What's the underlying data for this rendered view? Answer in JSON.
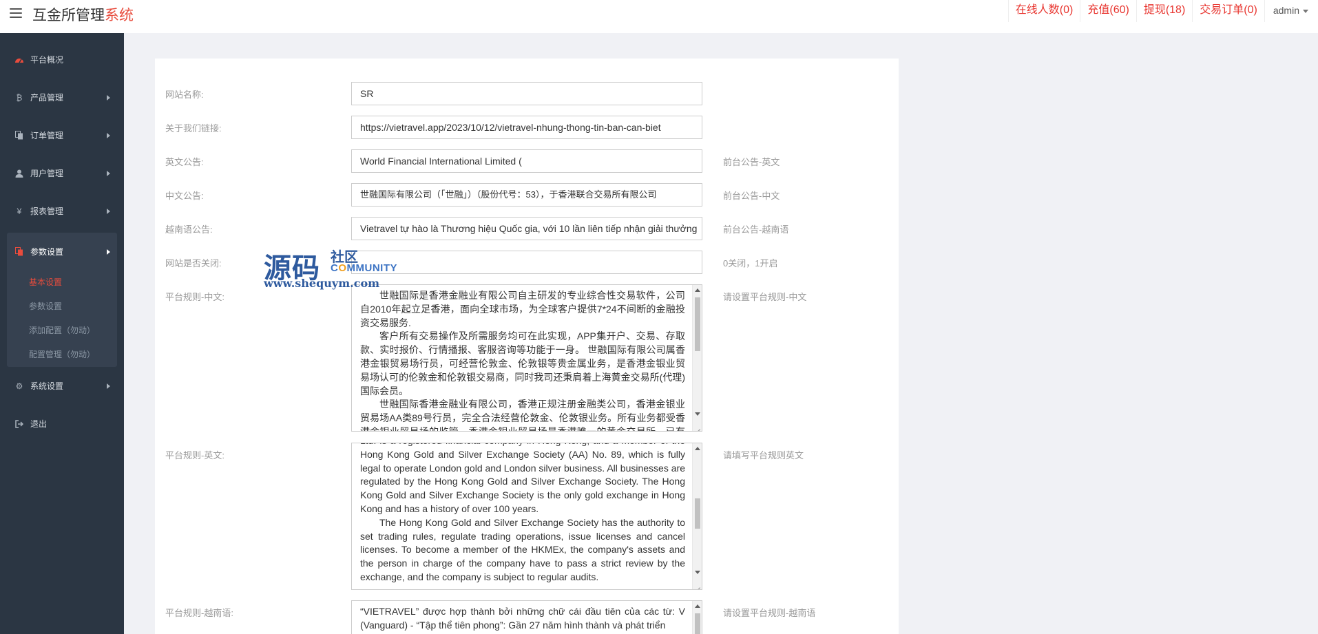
{
  "header": {
    "brand_main": "互金所管理",
    "brand_accent": "系统",
    "nav": {
      "online": "在线人数(0)",
      "recharge": "充值(60)",
      "withdraw": "提现(18)",
      "orders": "交易订单(0)",
      "user": "admin"
    }
  },
  "sidebar": {
    "items": [
      {
        "label": "平台概况",
        "icon": "dashboard-icon"
      },
      {
        "label": "产品管理",
        "icon": "bitcoin-icon"
      },
      {
        "label": "订单管理",
        "icon": "copy-icon"
      },
      {
        "label": "用户管理",
        "icon": "user-icon"
      },
      {
        "label": "报表管理",
        "icon": "yen-icon"
      }
    ],
    "active_group": {
      "label": "参数设置",
      "icon": "files-icon",
      "children": [
        "基本设置",
        "参数设置",
        "添加配置（勿动）",
        "配置管理（勿动）"
      ]
    },
    "bottom_items": [
      {
        "label": "系统设置",
        "icon": "gears-icon"
      },
      {
        "label": "退出",
        "icon": "sign-out-icon"
      }
    ]
  },
  "form": {
    "site_name": {
      "label": "网站名称:",
      "value": "SR"
    },
    "about_link": {
      "label": "关于我们链接:",
      "value": "https://vietravel.app/2023/10/12/vietravel-nhung-thong-tin-ban-can-biet"
    },
    "notice_en": {
      "label": "英文公告:",
      "value": "World Financial International Limited (",
      "hint": "前台公告-英文"
    },
    "notice_cn": {
      "label": "中文公告:",
      "value": "世融国际有限公司（「世融」）（股份代号：53），于香港联合交易所有限公司",
      "hint": "前台公告-中文"
    },
    "notice_vi": {
      "label": "越南语公告:",
      "value": "Vietravel tự hào là Thương hiệu Quốc gia, với 10 lần liên tiếp nhận giải thưởng",
      "hint": "前台公告-越南语"
    },
    "site_closed": {
      "label": "网站是否关闭:",
      "value": "",
      "hint": "0关闭，1开启"
    },
    "rules_cn": {
      "label": "平台规则-中文:",
      "hint": "请设置平台规则-中文",
      "paragraphs": [
        "世融国际是香港金融业有限公司自主研发的专业综合性交易软件，公司自2010年起立足香港，面向全球市场，为全球客户提供7*24不间断的金融投资交易服务.",
        "客户所有交易操作及所需服务均可在此实现，APP集开户、交易、存取款、实时报价、行情播报、客服咨询等功能于一身。 世融国际有限公司属香港金银贸易场行员，可经营伦敦金、伦敦银等贵金属业务，是香港金银业贸易场认可的伦敦金和伦敦银交易商，同时我司还秉肩着上海黄金交易所(代理)国际会员。",
        "世融国际香港金融业有限公司，香港正规注册金融类公司，香港金银业贸易场AA类89号行员，完全合法经营伦敦金、伦敦银业务。所有业务都受香港金银业贸易场的监管，香港金银业贸易场是香港唯一的黄金交易所，已有百年历史。"
      ]
    },
    "rules_en": {
      "label": "平台规则-英文:",
      "hint": "请填写平台规则英文",
      "paragraphs": [
        "Ltd. is a registered financial company in Hong Kong, and a member of the Hong Kong Gold and Silver Exchange Society (AA) No. 89, which is fully legal to operate London gold and London silver business. All businesses are regulated by the Hong Kong Gold and Silver Exchange Society. The Hong Kong Gold and Silver Exchange Society is the only gold exchange in Hong Kong and has a history of over 100 years.",
        "The Hong Kong Gold and Silver Exchange Society has the authority to set trading rules, regulate trading operations, issue licenses and cancel licenses. To become a member of the HKMEx, the company's assets and the person in charge of the company have to pass a strict review by the exchange, and the company is subject to regular audits."
      ]
    },
    "rules_vi": {
      "label": "平台规则-越南语:",
      "hint": "请设置平台规则-越南语",
      "paragraphs": [
        "“VIETRAVEL” được hợp thành bởi những chữ cái đầu tiên của các từ: V (Vanguard) - “Tập thể tiên phong”: Gần 27 năm hình thành và phát triển"
      ]
    }
  },
  "watermark": {
    "main": "源码",
    "sub": "社区",
    "community_pre": "C",
    "community_o": "O",
    "community_post": "MMUNITY",
    "url": "www.shequym.com"
  }
}
